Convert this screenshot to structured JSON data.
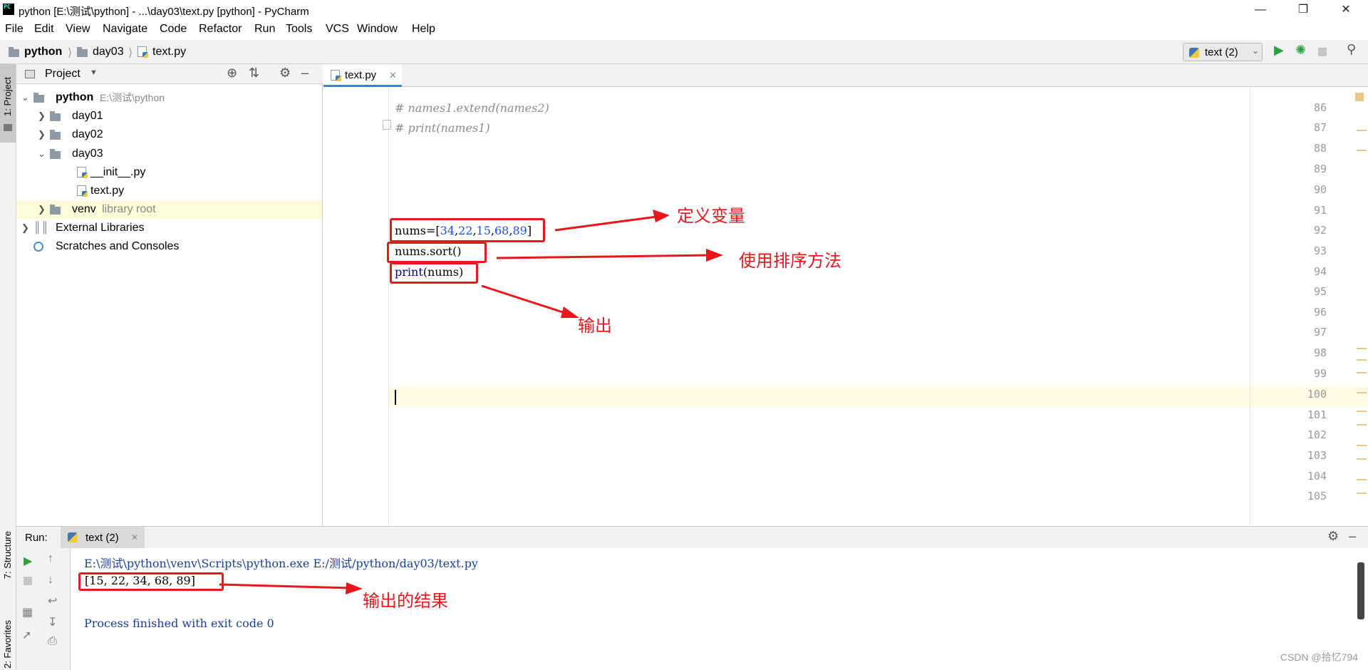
{
  "window": {
    "title": "python [E:\\测试\\python] - ...\\day03\\text.py [python] - PyCharm",
    "logo_text": "PC"
  },
  "menu": [
    "File",
    "Edit",
    "View",
    "Navigate",
    "Code",
    "Refactor",
    "Run",
    "Tools",
    "VCS",
    "Window",
    "Help"
  ],
  "breadcrumbs": [
    "python",
    "day03",
    "text.py"
  ],
  "run_config": {
    "label": "text (2)"
  },
  "left_tools": {
    "project": "1: Project",
    "structure": "7: Structure",
    "favorites": "2: Favorites"
  },
  "project_panel": {
    "title": "Project",
    "tree": [
      {
        "name": "python",
        "hint": "E:\\测试\\python",
        "type": "root"
      },
      {
        "name": "day01",
        "type": "folder"
      },
      {
        "name": "day02",
        "type": "folder"
      },
      {
        "name": "day03",
        "type": "folder"
      },
      {
        "name": "__init__.py",
        "type": "file"
      },
      {
        "name": "text.py",
        "type": "file"
      },
      {
        "name": "venv",
        "hint": "library root",
        "type": "folder"
      },
      {
        "name": "External Libraries",
        "type": "libs"
      },
      {
        "name": "Scratches and Consoles",
        "type": "scratch"
      }
    ]
  },
  "editor": {
    "tab": "text.py",
    "line_numbers": [
      "86",
      "87",
      "88",
      "89",
      "90",
      "91",
      "92",
      "93",
      "94",
      "95",
      "96",
      "97",
      "98",
      "99",
      "100",
      "101",
      "102",
      "103",
      "104",
      "105"
    ],
    "lines": {
      "l86": "# names1.extend(names2)",
      "l87": "# print(names1)",
      "l92_a": "nums=[",
      "l92_n1": "34",
      "l92_n2": "22",
      "l92_n3": "15",
      "l92_n4": "68",
      "l92_n5": "89",
      "l92_z": "]",
      "l93": "nums.sort()",
      "l94_kw": "print",
      "l94_rest": "(nums)"
    }
  },
  "annotations": {
    "define": "定义变量",
    "sort": "使用排序方法",
    "output": "输出",
    "result": "输出的结果"
  },
  "run_panel": {
    "label": "Run:",
    "tab": "text (2)",
    "cmd": "E:\\测试\\python\\venv\\Scripts\\python.exe E:/测试/python/day03/text.py",
    "output": "[15, 22, 34, 68, 89]",
    "exit": "Process finished with exit code 0"
  },
  "watermark": "CSDN @拾忆794",
  "colors": {
    "accent": "#4083c9",
    "annotation": "#e8171c",
    "number": "#1750eb",
    "keyword": "#000080"
  }
}
